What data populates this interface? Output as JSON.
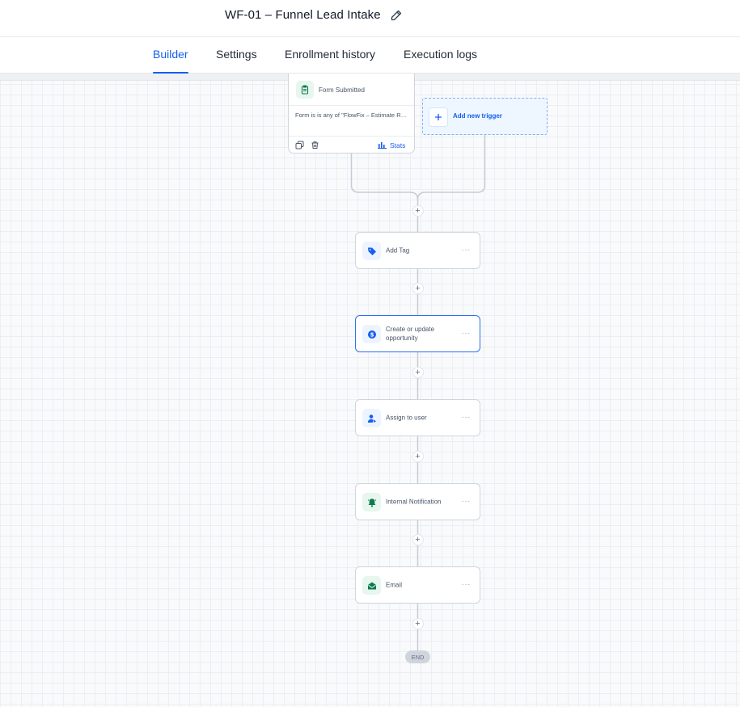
{
  "header": {
    "title": "WF-01 – Funnel Lead Intake",
    "edit_icon": "pencil-icon"
  },
  "tabs": [
    {
      "label": "Builder",
      "active": true
    },
    {
      "label": "Settings",
      "active": false
    },
    {
      "label": "Enrollment history",
      "active": false
    },
    {
      "label": "Execution logs",
      "active": false
    }
  ],
  "trigger": {
    "title": "Form Submitted",
    "condition": "Form is is any of \"FlowFix – Estimate Request\"",
    "stats_label": "Stats",
    "icons": [
      "clipboard-icon",
      "copy-icon",
      "trash-icon",
      "bar-chart-icon"
    ]
  },
  "add_trigger": {
    "label": "Add new trigger",
    "icon": "plus-icon"
  },
  "actions": [
    {
      "label": "Add Tag",
      "icon": "tag-icon",
      "selected": false
    },
    {
      "label": "Create or update opportunity",
      "icon": "dollar-icon",
      "selected": true
    },
    {
      "label": "Assign to user",
      "icon": "user-assign-icon",
      "selected": false
    },
    {
      "label": "Internal Notification",
      "icon": "bell-icon",
      "selected": false
    },
    {
      "label": "Email",
      "icon": "mail-icon",
      "selected": false
    }
  ],
  "plus_symbol": "+",
  "more_symbol": "···",
  "end_label": "END",
  "colors": {
    "accent": "#155eef",
    "selected_border": "#2e6ff2",
    "green_icon": "#0e7a4f",
    "blue_icon": "#155eef"
  }
}
